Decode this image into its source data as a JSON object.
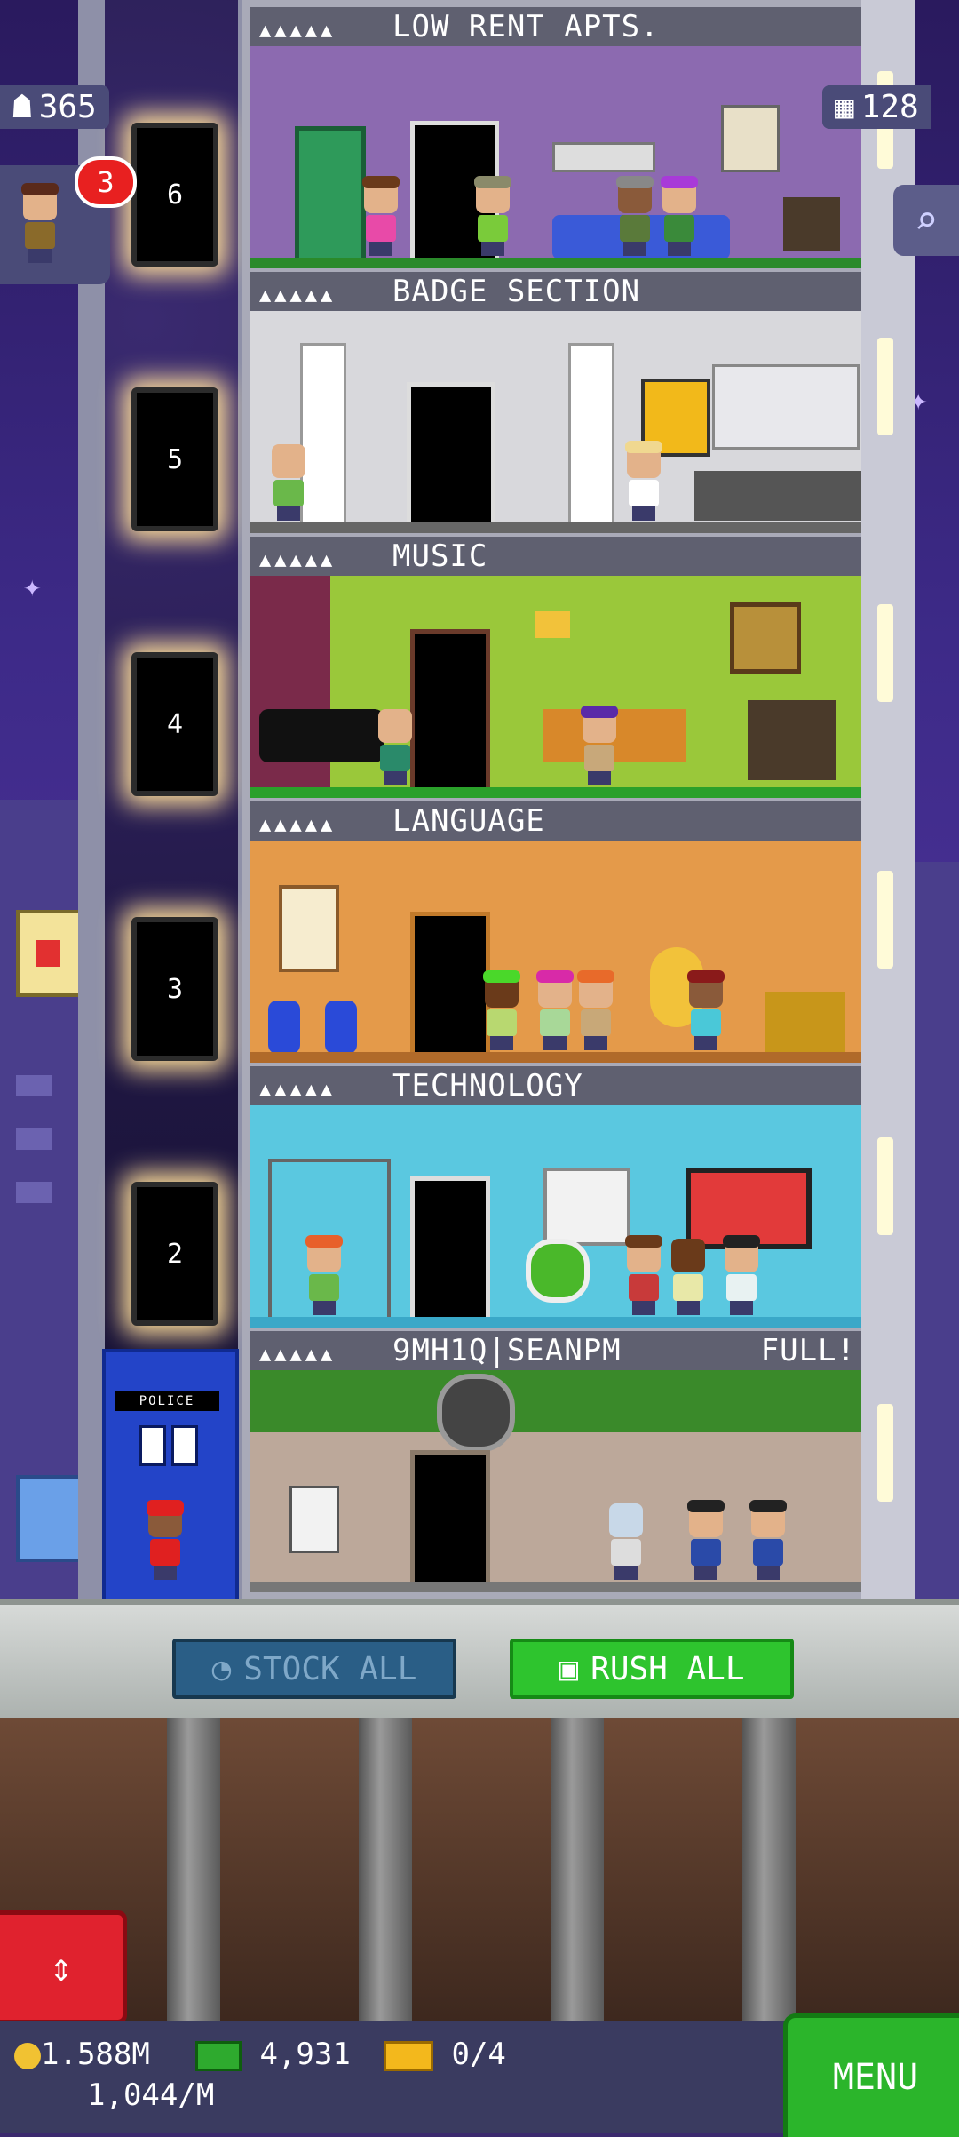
{
  "hud": {
    "population": "365",
    "floors_count": "128",
    "visitor_notifications": "3"
  },
  "floors": [
    {
      "name": "LOW RENT APTS.",
      "elevator_number": "6",
      "status": ""
    },
    {
      "name": "BADGE SECTION",
      "elevator_number": "5",
      "status": ""
    },
    {
      "name": "MUSIC",
      "elevator_number": "4",
      "status": ""
    },
    {
      "name": "LANGUAGE",
      "elevator_number": "3",
      "status": ""
    },
    {
      "name": "TECHNOLOGY",
      "elevator_number": "2",
      "status": ""
    },
    {
      "name": "9MH1Q|SEANPM",
      "elevator_number": "",
      "status": "FULL!"
    }
  ],
  "floor_stars": "▲▲▲▲▲",
  "tardis_sign": "POLICE",
  "actions": {
    "stock_all": "STOCK ALL",
    "rush_all": "RUSH ALL"
  },
  "currency": {
    "coins": "1.588M",
    "coins_rate": "1,044/M",
    "bux": "4,931",
    "tickets": "0/4"
  },
  "menu_label": "MENU",
  "colors": {
    "rush_green": "#2ec42e",
    "stock_blue": "#2a5e86",
    "elevator_red": "#e0222e",
    "menu_green": "#2bb52b"
  }
}
